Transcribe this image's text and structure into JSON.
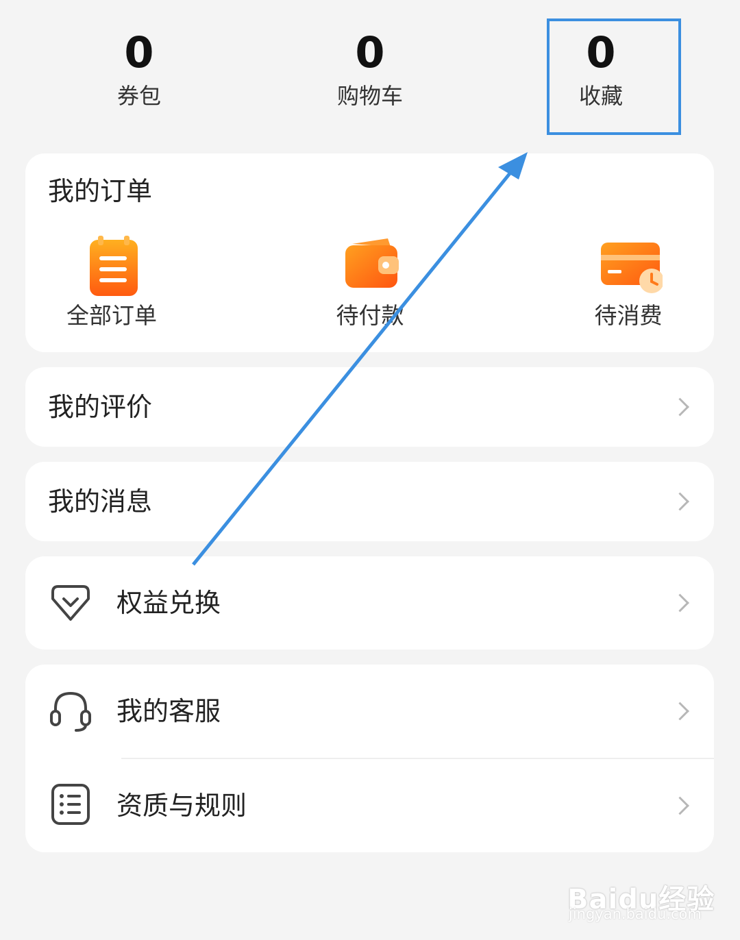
{
  "stats": [
    {
      "value": "0",
      "label": "券包"
    },
    {
      "value": "0",
      "label": "购物车"
    },
    {
      "value": "0",
      "label": "收藏"
    }
  ],
  "orders": {
    "title": "我的订单",
    "items": [
      {
        "label": "全部订单",
        "icon": "notepad-icon"
      },
      {
        "label": "待付款",
        "icon": "wallet-icon"
      },
      {
        "label": "待消费",
        "icon": "card-clock-icon"
      }
    ]
  },
  "menu": {
    "reviews": "我的评价",
    "messages": "我的消息",
    "rights_exchange": "权益兑换",
    "customer_service": "我的客服",
    "qualifications": "资质与规则"
  },
  "watermark": {
    "logo": "Baidu经验",
    "url": "jingyan.baidu.com"
  },
  "colors": {
    "highlight": "#3b8fe0",
    "accent_orange": "#ff7a1a",
    "background": "#f4f4f4"
  }
}
